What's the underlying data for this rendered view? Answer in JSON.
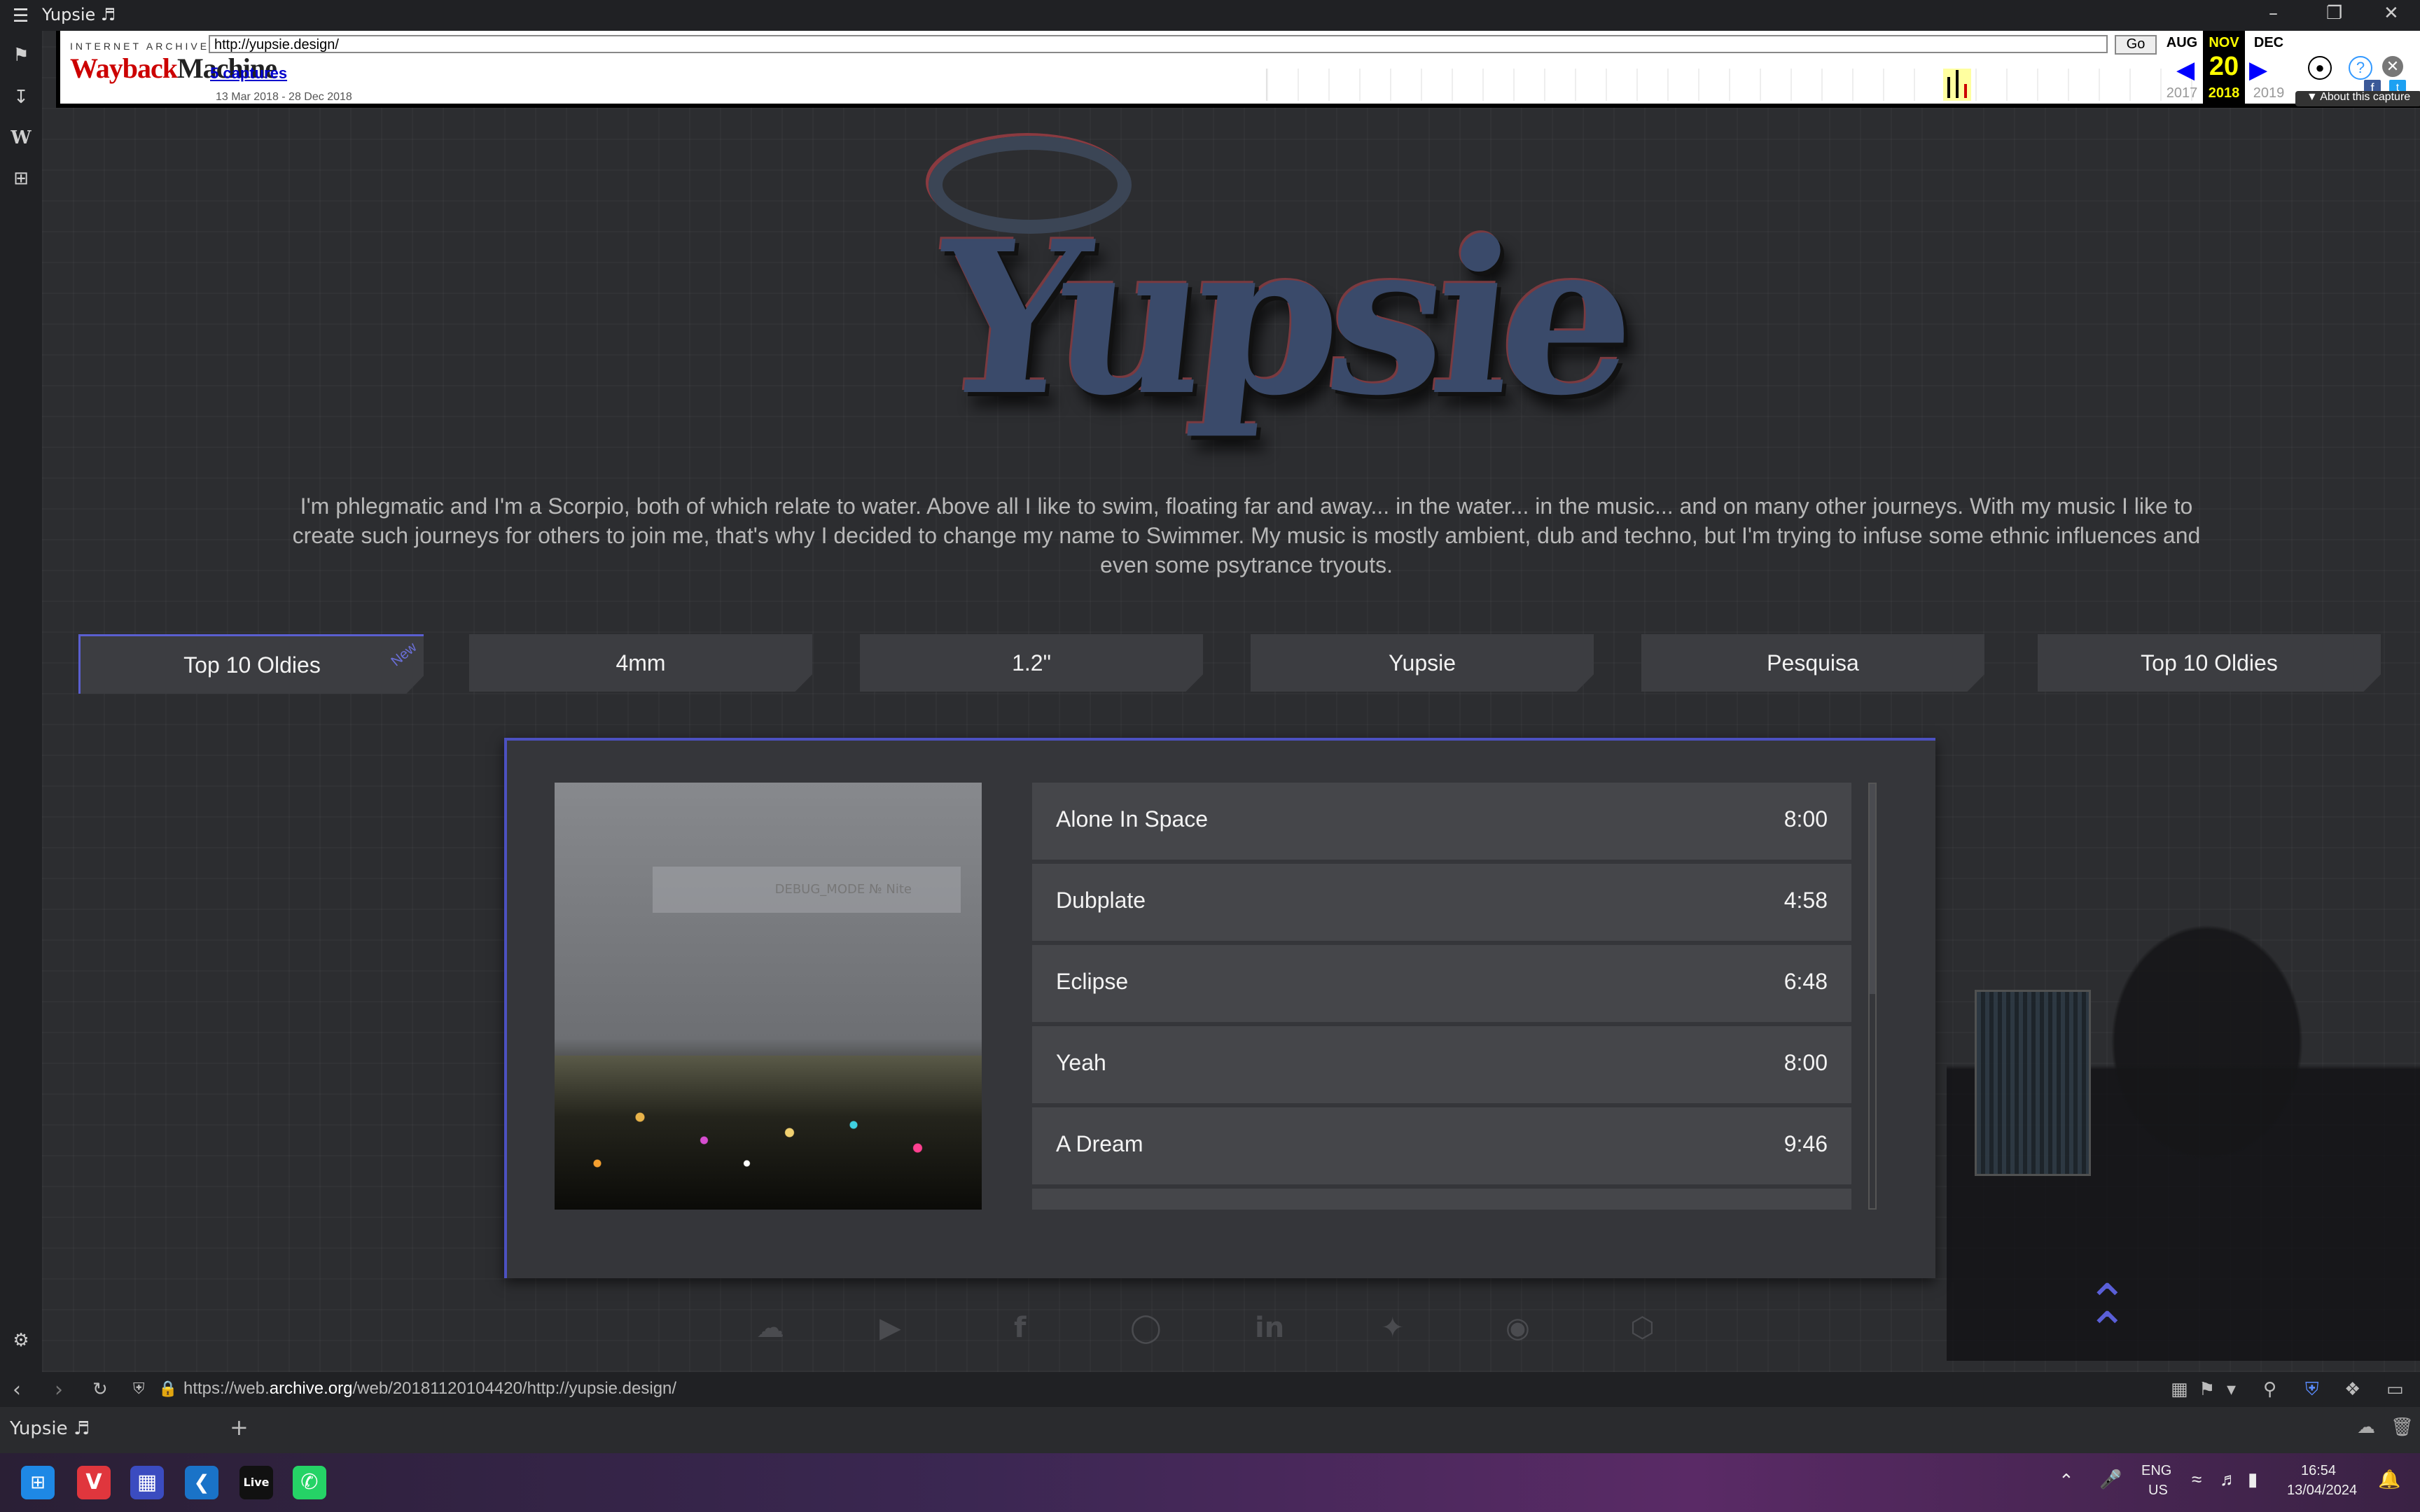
{
  "window": {
    "title": "Yupsie ♬"
  },
  "wayback": {
    "brand_top": "INTERNET ARCHIVE",
    "brand_logo_a": "Wayback",
    "brand_logo_b": "Machine",
    "url": "http://yupsie.design/",
    "go_label": "Go",
    "captures_link": "5 captures",
    "date_range": "13 Mar 2018 - 28 Dec 2018",
    "prev_month": "AUG",
    "cur_month": "NOV",
    "next_month": "DEC",
    "prev_year": "2017",
    "cur_year": "2018",
    "next_year": "2019",
    "day": "20",
    "about_label": "▼ About this capture"
  },
  "site": {
    "bio": "I'm phlegmatic and I'm a Scorpio, both of which relate to water. Above all I like to swim, floating far and away... in the water... in the music... and on many other journeys. With my music I like to create such journeys for others to join me, that's why I decided to change my name to Swimmer. My music is mostly ambient, dub and techno, but I'm trying to infuse some ethnic influences and even some psytrance tryouts.",
    "logo_text": "Yupsie",
    "tabs": [
      {
        "label": "Top 10 Oldies",
        "badge": "New"
      },
      {
        "label": "4mm"
      },
      {
        "label": "1.2\""
      },
      {
        "label": "Yupsie"
      },
      {
        "label": "Pesquisa"
      },
      {
        "label": "Top 10 Oldies"
      }
    ],
    "cover_banner": "DEBUG_MODE № Nite",
    "tracks": [
      {
        "title": "Alone In Space",
        "duration": "8:00"
      },
      {
        "title": "Dubplate",
        "duration": "4:58"
      },
      {
        "title": "Eclipse",
        "duration": "6:48"
      },
      {
        "title": "Yeah",
        "duration": "8:00"
      },
      {
        "title": "A Dream",
        "duration": "9:46"
      }
    ],
    "social_icons": [
      "soundcloud-icon",
      "youtube-icon",
      "facebook-icon",
      "instagram-icon",
      "linkedin-icon",
      "twitter-icon",
      "github-icon",
      "codepen-icon"
    ]
  },
  "addressbar": {
    "url_prefix": "https://web.",
    "url_domain": "archive.org",
    "url_rest": "/web/20181120104420/http://yupsie.design/"
  },
  "tabbar": {
    "tab_title": "Yupsie ♬"
  },
  "system": {
    "lang": "ENG",
    "region": "US",
    "time": "16:54",
    "date": "13/04/2024"
  }
}
